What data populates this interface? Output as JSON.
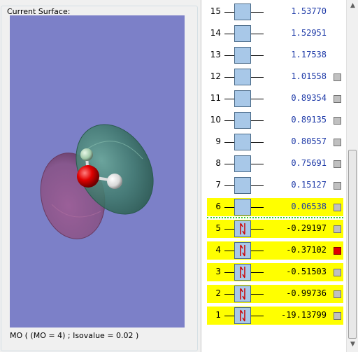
{
  "surface_panel": {
    "title": "Current Surface:",
    "mo_label": "MO ( (MO = 4) ; Isovalue = 0.02 )"
  },
  "orbitals": [
    {
      "number": "15",
      "energy": "1.53770",
      "occupied": false,
      "highlight": false,
      "selector": "none"
    },
    {
      "number": "14",
      "energy": "1.52951",
      "occupied": false,
      "highlight": false,
      "selector": "none"
    },
    {
      "number": "13",
      "energy": "1.17538",
      "occupied": false,
      "highlight": false,
      "selector": "none"
    },
    {
      "number": "12",
      "energy": "1.01558",
      "occupied": false,
      "highlight": false,
      "selector": "gray"
    },
    {
      "number": "11",
      "energy": "0.89354",
      "occupied": false,
      "highlight": false,
      "selector": "gray"
    },
    {
      "number": "10",
      "energy": "0.89135",
      "occupied": false,
      "highlight": false,
      "selector": "gray"
    },
    {
      "number": "9",
      "energy": "0.80557",
      "occupied": false,
      "highlight": false,
      "selector": "gray"
    },
    {
      "number": "8",
      "energy": "0.75691",
      "occupied": false,
      "highlight": false,
      "selector": "gray"
    },
    {
      "number": "7",
      "energy": "0.15127",
      "occupied": false,
      "highlight": false,
      "selector": "gray"
    },
    {
      "number": "6",
      "energy": "0.06538",
      "occupied": false,
      "highlight": true,
      "selector": "gray"
    },
    {
      "number": "5",
      "energy": "-0.29197",
      "occupied": true,
      "highlight": true,
      "selector": "gray"
    },
    {
      "number": "4",
      "energy": "-0.37102",
      "occupied": true,
      "highlight": true,
      "selector": "red"
    },
    {
      "number": "3",
      "energy": "-0.51503",
      "occupied": true,
      "highlight": true,
      "selector": "gray"
    },
    {
      "number": "2",
      "energy": "-0.99736",
      "occupied": true,
      "highlight": true,
      "selector": "gray"
    },
    {
      "number": "1",
      "energy": "-19.13799",
      "occupied": true,
      "highlight": true,
      "selector": "gray"
    }
  ],
  "colors": {
    "viewport_bg": "#7c80c8",
    "highlight": "#ffff00",
    "virtual_energy": "#1e3aa8",
    "selected": "#e00000",
    "lobe_positive": "#3e7a6a",
    "lobe_negative": "#8a4a7a",
    "oxygen": "#e00000",
    "hydrogen": "#ffffff"
  },
  "icons": {
    "electron_pair": "up-down-arrows-icon",
    "scroll_up": "chevron-up-icon",
    "scroll_down": "chevron-down-icon"
  }
}
